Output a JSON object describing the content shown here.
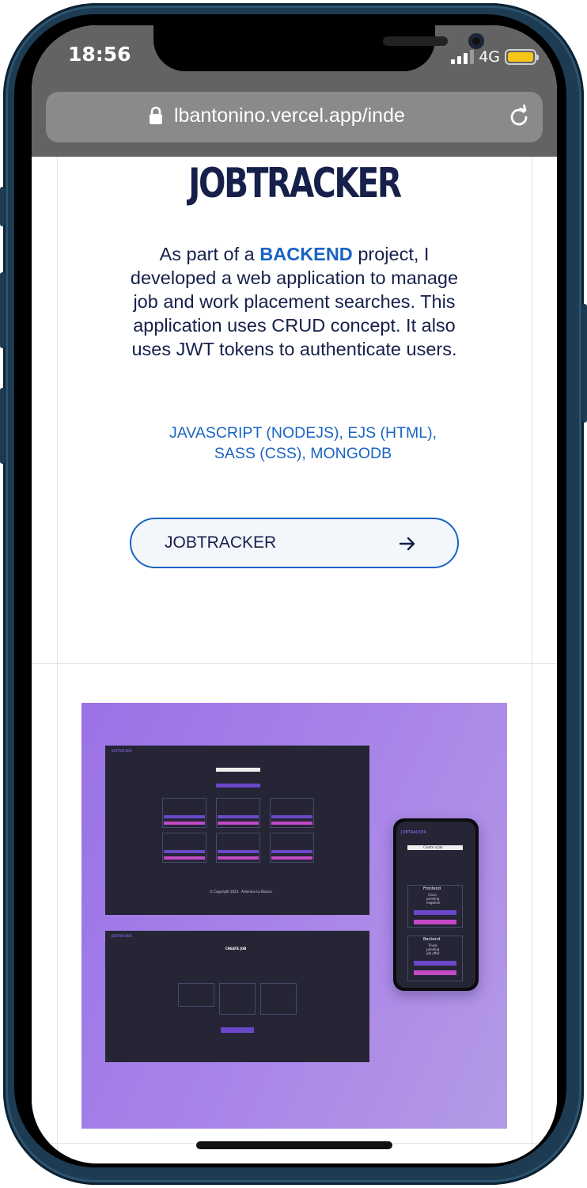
{
  "status": {
    "time": "18:56",
    "network": "4G"
  },
  "browser": {
    "url": "lbantonino.vercel.app/inde"
  },
  "project": {
    "title": "JOBTRACKER",
    "description_prefix": "As part of a",
    "description_highlight": "BACKEND",
    "description_suffix": "project, I developed a web application to manage job and work placement searches. This application uses CRUD concept. It also uses JWT tokens to authenticate users.",
    "tech_line1": "JAVASCRIPT (NODEJS), EJS (HTML),",
    "tech_line2": "SASS (CSS), MONGODB",
    "button_label": "JOBTRACKER"
  },
  "preview": {
    "desktop_logo": "JOBTRACKER",
    "create_job_heading": "CREATE JOB",
    "copyright": "© Copyright 2023 · Antonino Lo Bianco",
    "mobile_logo": "JOBTRACKER",
    "mobile_button": "Create a Job",
    "mobile_cards": [
      {
        "title": "Frontend",
        "company": "Cisco",
        "status": "pending",
        "meta": "negative"
      },
      {
        "title": "Backend",
        "company": "Trivial",
        "status": "pending",
        "meta": "job offer"
      }
    ],
    "mobile_edit": "Edit",
    "mobile_delete": "Delete"
  },
  "colors": {
    "title": "#16204a",
    "accent": "#1a64c2",
    "preview_bg": "#a986e8",
    "dark_panel": "#252536"
  }
}
